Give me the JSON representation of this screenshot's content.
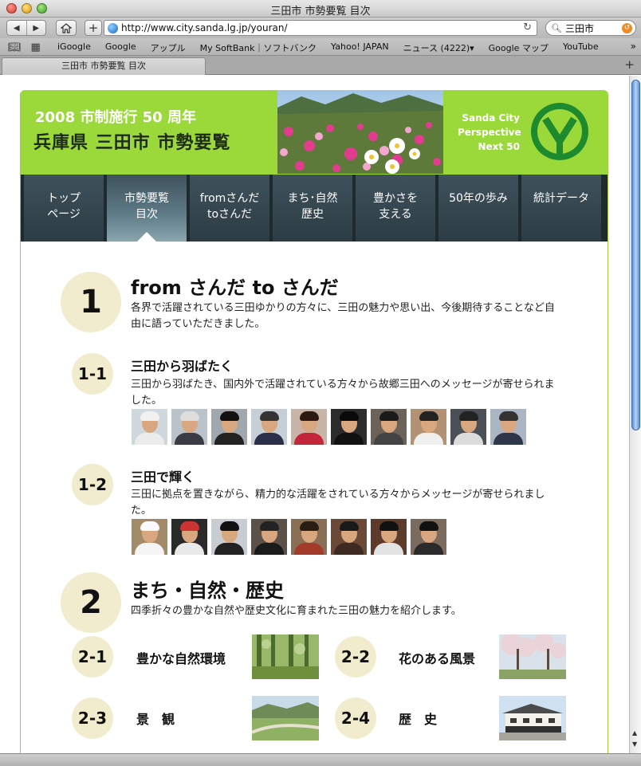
{
  "window": {
    "title": "三田市 市勢要覧 目次"
  },
  "toolbar": {
    "url": "http://www.city.sanda.lg.jp/youran/",
    "search_value": "三田市"
  },
  "bookmarks": [
    "iGoogle",
    "Google",
    "アップル",
    "My SoftBank｜ソフトバンク",
    "Yahoo! JAPAN",
    "ニュース (4222)▾",
    "Google マップ",
    "YouTube"
  ],
  "tab": {
    "label": "三田市 市勢要覧 目次"
  },
  "header": {
    "year_line": "2008 市制施行 50 周年",
    "title": "兵庫県 三田市 市勢要覧",
    "tagline": [
      "Sanda City",
      "Perspective",
      "Next 50"
    ]
  },
  "nav": [
    {
      "line1": "トップ",
      "line2": "ページ"
    },
    {
      "line1": "市勢要覧",
      "line2": "目次"
    },
    {
      "line1": "fromさんだ",
      "line2": "toさんだ"
    },
    {
      "line1": "まち･自然",
      "line2": "歴史"
    },
    {
      "line1": "豊かさを",
      "line2": "支える"
    },
    {
      "line1": "50年の歩み",
      "line2": ""
    },
    {
      "line1": "統計データ",
      "line2": ""
    }
  ],
  "sections": {
    "s1": {
      "num": "1",
      "title": "from さんだ to さんだ",
      "desc": "各界で活躍されている三田ゆかりの方々に、三田の魅力や思い出、今後期待することなど自由に語っていただきました。"
    },
    "s1_1": {
      "num": "1-1",
      "title": "三田から羽ばたく",
      "desc": "三田から羽ばたき、国内外で活躍されている方々から故郷三田へのメッセージが寄せられました。"
    },
    "s1_2": {
      "num": "1-2",
      "title": "三田で輝く",
      "desc": "三田に拠点を置きながら、精力的な活躍をされている方々からメッセージが寄せられました。"
    },
    "s2": {
      "num": "2",
      "title": "まち・自然・歴史",
      "desc": "四季折々の豊かな自然や歴史文化に育まれた三田の魅力を紹介します。"
    },
    "s2_1": {
      "num": "2-1",
      "title": "豊かな自然環境"
    },
    "s2_2": {
      "num": "2-2",
      "title": "花のある風景"
    },
    "s2_3": {
      "num": "2-3",
      "title": "景　観"
    },
    "s2_4": {
      "num": "2-4",
      "title": "歴　史"
    }
  },
  "colors": {
    "brand_green": "#9bd93b",
    "nav_dark": "#2d3c44",
    "circle_bg": "#f2ecce"
  }
}
